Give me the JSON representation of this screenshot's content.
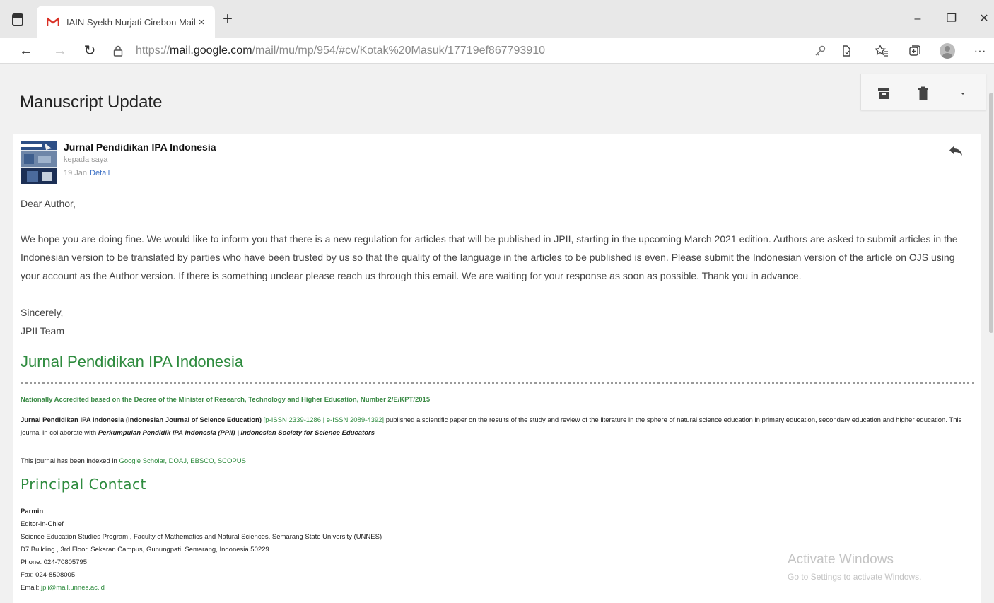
{
  "browser": {
    "tab_title": "IAIN Syekh Nurjati Cirebon Mail",
    "tab_close": "×",
    "new_tab": "+",
    "url_prefix": "https://",
    "url_domain": "mail.google.com",
    "url_path": "/mail/mu/mp/954/#cv/Kotak%20Masuk/17719ef867793910",
    "window_controls": {
      "minimize": "–",
      "restore": "❐",
      "close": "✕"
    },
    "nav": {
      "back": "←",
      "forward": "→",
      "reload": "↻"
    },
    "toolbar_icons": [
      "key-icon",
      "read-aloud-icon",
      "favorites-icon",
      "collections-icon",
      "profile-icon",
      "more-icon"
    ],
    "more_label": "···"
  },
  "email": {
    "subject": "Manuscript Update",
    "sender": "Jurnal Pendidikan IPA Indonesia",
    "recipient": "kepada saya",
    "date": "19 Jan",
    "detail_link": "Detail",
    "greeting": "Dear Author,",
    "paragraph": "We hope you are doing fine. We would like to inform you that there is a new regulation for articles that will be published in JPII, starting in the upcoming March 2021 edition. Authors are asked to submit articles in the Indonesian version to be translated by parties who have been trusted by us so that the quality of the language in the articles to be published is even. Please submit the Indonesian version of the article on OJS using your account as the Author version. If there is something unclear please reach us through this email. We are waiting for your response as soon as possible. Thank you in advance.",
    "closing": "Sincerely,",
    "signature": "JPII Team"
  },
  "signature_block": {
    "journal_title": "Jurnal Pendidikan IPA Indonesia",
    "accredited": "Nationally Accredited based on the Decree of the Minister of Research, Technology and Higher Education, Number 2/E/KPT/2015",
    "desc_bold": "Jurnal Pendidikan IPA Indonesia (Indonesian Journal of Science Education)",
    "desc_issn": "[p-ISSN 2339-1286 | e-ISSN 2089-4392]",
    "desc_rest": " published a scientific paper on the results of the study and review of the literature in the sphere of natural science education in primary education, secondary education and higher education. This journal in collaborate with ",
    "desc_partner": "Perkumpulan Pendidik IPA Indonesia (PPII) | Indonesian Society for Science Educators",
    "indexed_prefix": "This journal has been indexed in ",
    "indexed_links": "Google Scholar, DOAJ, EBSCO, SCOPUS",
    "principal_contact_title": "Principal Contact",
    "contact_name": "Parmin",
    "contact_role": "Editor-in-Chief",
    "contact_affiliation": "Science Education Studies Program , Faculty of Mathematics and Natural Sciences, Semarang State University (UNNES)",
    "contact_address": "D7 Building , 3rd Floor, Sekaran Campus, Gunungpati, Semarang, Indonesia 50229",
    "contact_phone": "Phone: 024-70805795",
    "contact_fax": "Fax: 024-8508005",
    "contact_email_label": "Email: ",
    "contact_email": "jpii@mail.unnes.ac.id"
  },
  "watermark": {
    "line1": "Activate Windows",
    "line2": "Go to Settings to activate Windows."
  },
  "colors": {
    "accent_green": "#2e8b3e",
    "gmail_red": "#d93025",
    "link_blue": "#3b6fc4"
  }
}
